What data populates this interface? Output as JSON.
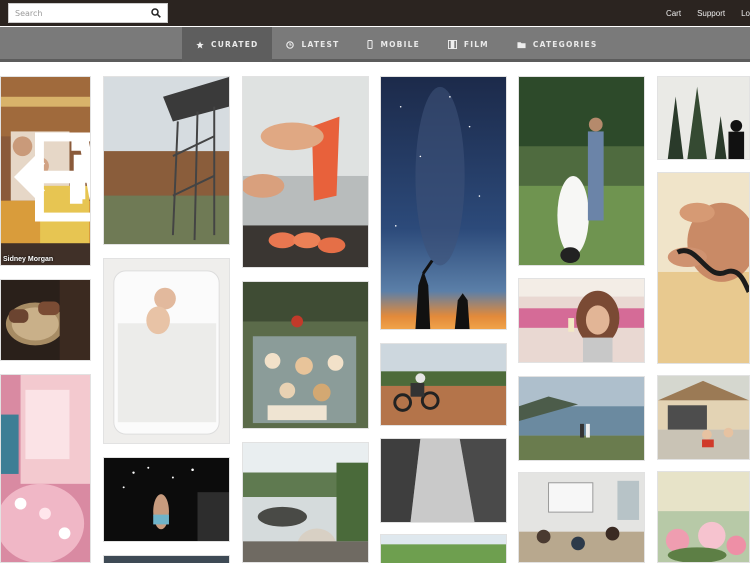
{
  "header": {
    "search": {
      "placeholder": "Search",
      "value": ""
    },
    "links": [
      "Cart",
      "Support",
      "Lo"
    ]
  },
  "nav": {
    "tabs": [
      {
        "label": "CURATED",
        "icon": "star-icon",
        "active": true
      },
      {
        "label": "LATEST",
        "icon": "clock-icon",
        "active": false
      },
      {
        "label": "MOBILE",
        "icon": "phone-icon",
        "active": false
      },
      {
        "label": "FILM",
        "icon": "film-icon",
        "active": false
      },
      {
        "label": "CATEGORIES",
        "icon": "folder-icon",
        "active": false
      }
    ]
  },
  "gallery": {
    "featured_caption": "Sidney Morgan",
    "overlay_icons": [
      "back-arrow-icon",
      "plus-icon",
      "cart-icon"
    ]
  }
}
